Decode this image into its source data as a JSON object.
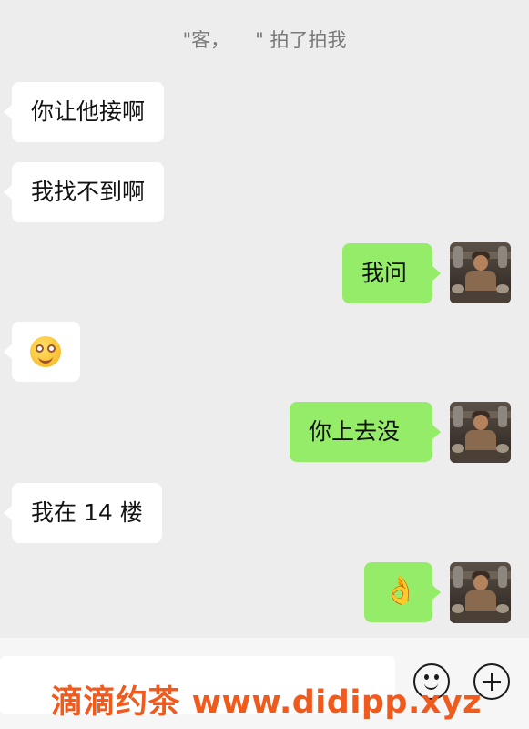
{
  "system_message": {
    "open_quote": "\"客，",
    "close_part": "\" 拍了拍我"
  },
  "messages": [
    {
      "side": "left",
      "text": "你让他接啊"
    },
    {
      "side": "left",
      "text": "我找不到啊"
    },
    {
      "side": "right",
      "text": "我问"
    },
    {
      "side": "left",
      "emoji": "drooling-face-emoji"
    },
    {
      "side": "right",
      "text": "你上去没"
    },
    {
      "side": "left",
      "text": "我在 14 楼"
    },
    {
      "side": "right",
      "emoji": "ok-hand-emoji",
      "glyph": "👌"
    }
  ],
  "input_bar": {
    "emoji_button": "smiley-icon",
    "plus_button": "plus-icon"
  },
  "watermark": "滴滴约茶 www.didipp.xyz"
}
